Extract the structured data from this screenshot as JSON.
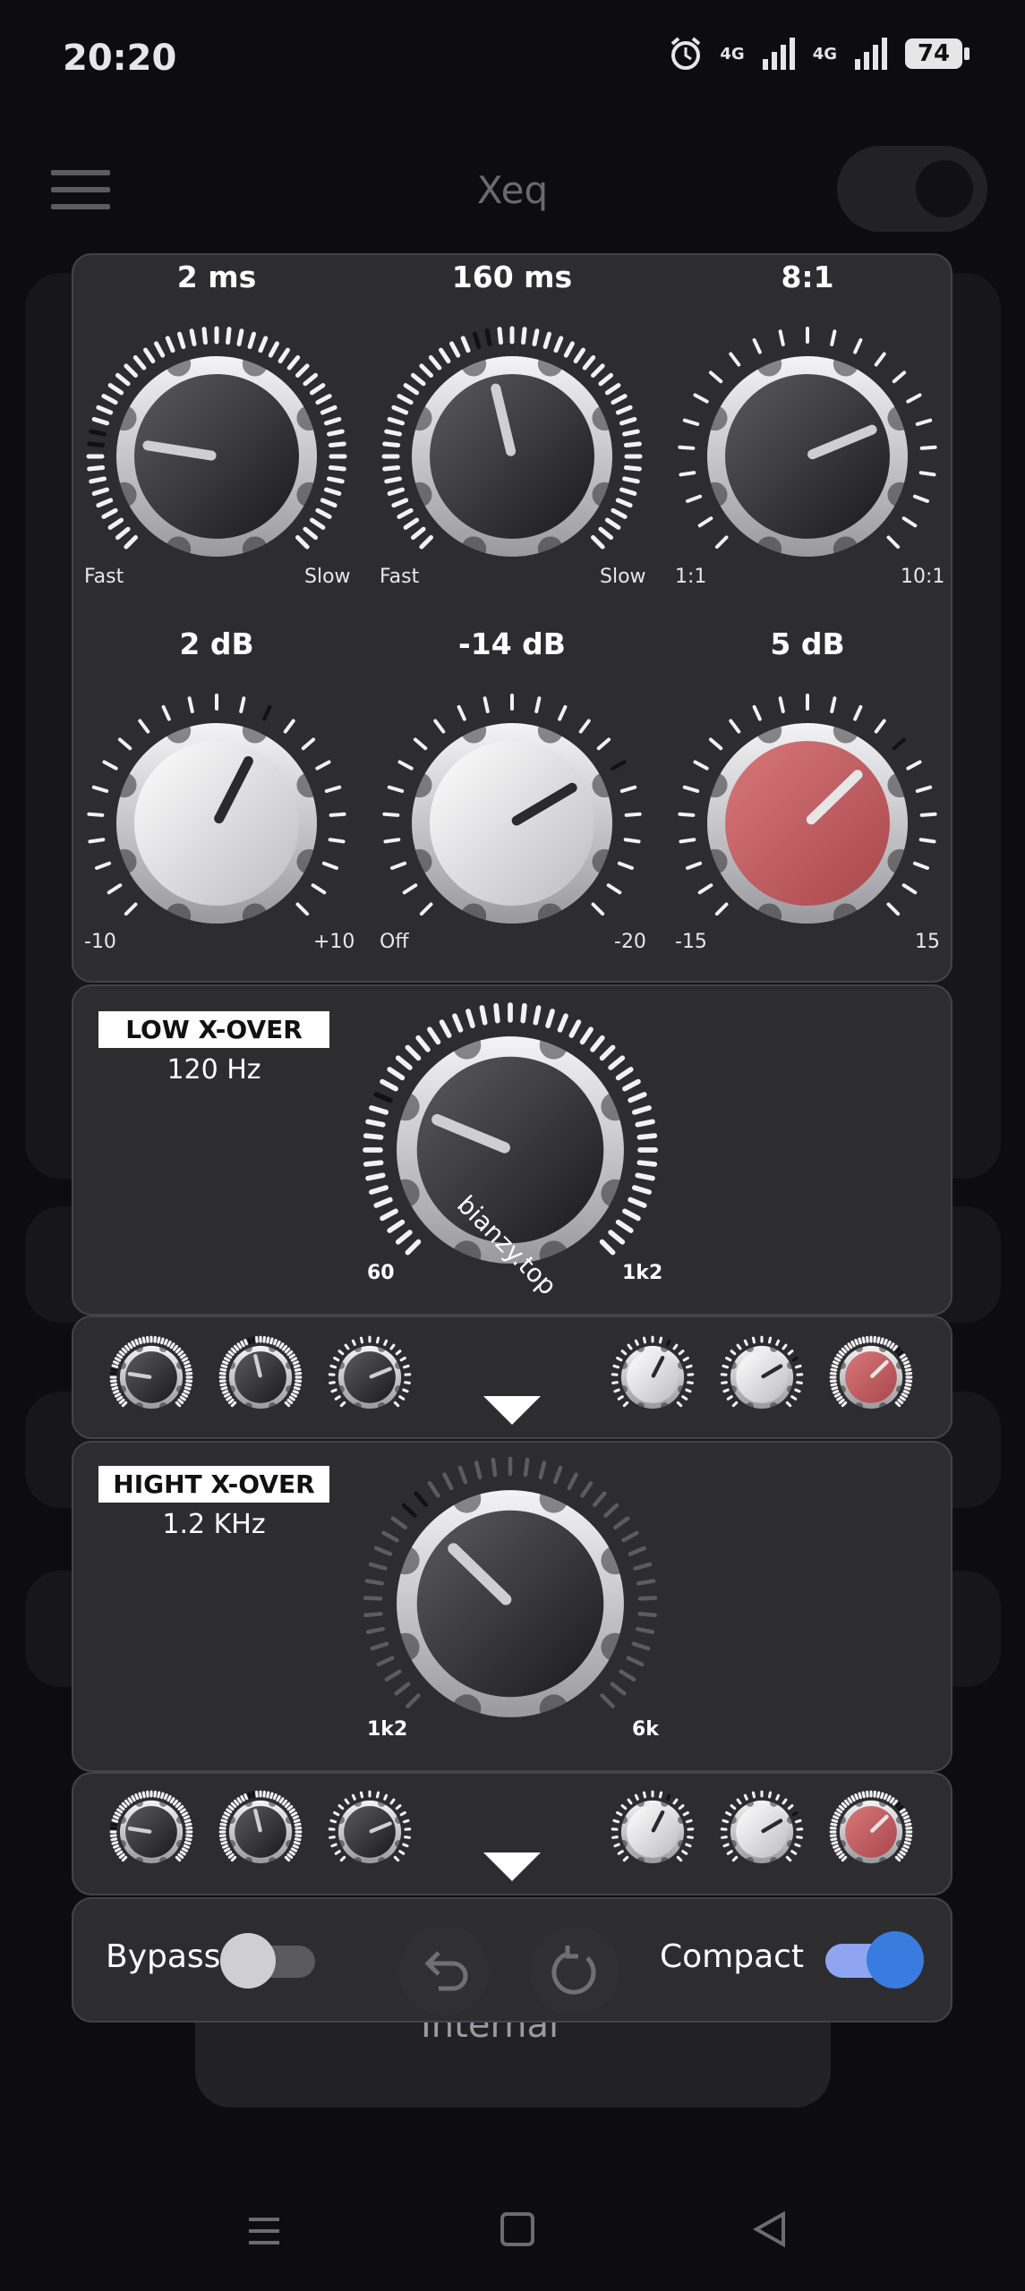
{
  "status": {
    "time": "20:20",
    "net1": "4G",
    "net2": "4G",
    "battery": "74"
  },
  "app": {
    "title": "Xeq",
    "footer_text": "Internal"
  },
  "compressor": {
    "row1": [
      {
        "value": "2 ms",
        "min": "Fast",
        "max": "Slow",
        "level": 0.2
      },
      {
        "value": "160 ms",
        "min": "Fast",
        "max": "Slow",
        "level": 0.45
      },
      {
        "value": "8:1",
        "min": "1:1",
        "max": "10:1",
        "level": 0.75
      }
    ],
    "row2": [
      {
        "value": "2 dB",
        "min": "-10",
        "max": "+10",
        "level": 0.6
      },
      {
        "value": "-14 dB",
        "min": "Off",
        "max": "-20",
        "level": 0.72
      },
      {
        "value": "5 dB",
        "min": "-15",
        "max": "15",
        "level": 0.67
      }
    ]
  },
  "low_xover": {
    "title": "LOW X-OVER",
    "value": "120 Hz",
    "min": "60",
    "max": "1k2",
    "watermark": "bianzy.top",
    "level": 0.25
  },
  "high_xover": {
    "title": "HIGHT X-OVER",
    "value": "1.2 KHz",
    "min": "1k2",
    "max": "6k",
    "level": 0.33
  },
  "toolbar": {
    "bypass_label": "Bypass",
    "compact_label": "Compact",
    "bypass_on": false,
    "compact_on": true
  },
  "colors": {
    "panel": "#2d2d30",
    "red_knob": "#c25a5e",
    "toggle_on": "#3a7be0"
  }
}
